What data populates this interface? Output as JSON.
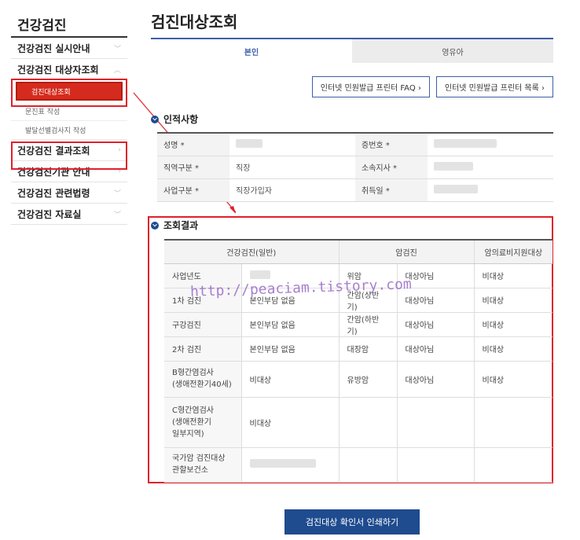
{
  "sidebar": {
    "title": "건강검진",
    "items": [
      {
        "label": "건강검진 실시안내"
      },
      {
        "label": "건강검진 대상자조회"
      },
      {
        "label": "건강검진 결과조회"
      },
      {
        "label": "건강검진기관 안내"
      },
      {
        "label": "건강검진 관련법령"
      },
      {
        "label": "건강검진 자료실"
      }
    ],
    "subitems": [
      {
        "label": "검진대상조회"
      },
      {
        "label": "문진표 작성"
      },
      {
        "label": "발달선별검사지 작성"
      }
    ]
  },
  "main": {
    "title": "검진대상조회",
    "tabs": [
      {
        "label": "본인"
      },
      {
        "label": "영유아"
      }
    ],
    "buttons": {
      "faq": "인터넷 민원발급 프린터 FAQ ›",
      "list": "인터넷 민원발급 프린터 목록 ›"
    },
    "personal": {
      "heading": "인적사항",
      "rows": [
        {
          "l1": "성명 *",
          "v1": "",
          "l2": "증번호 *",
          "v2": ""
        },
        {
          "l1": "직역구분 *",
          "v1": "직장",
          "l2": "소속지사 *",
          "v2": ""
        },
        {
          "l1": "사업구분 *",
          "v1": "직장가입자",
          "l2": "취득일 *",
          "v2": ""
        }
      ]
    },
    "results": {
      "heading": "조회결과",
      "headers": [
        "건강검진(일반)",
        "암검진",
        "암의료비지원대상"
      ],
      "rows": [
        {
          "label": "사업년도",
          "value": "",
          "cancer": "위암",
          "cancer_status": "대상아님",
          "support": "비대상"
        },
        {
          "label": "1차 검진",
          "value": "본인부담 없음",
          "cancer": "간암(상반기)",
          "cancer_status": "대상아님",
          "support": "비대상"
        },
        {
          "label": "구강검진",
          "value": "본인부담 없음",
          "cancer": "간암(하반기)",
          "cancer_status": "대상아님",
          "support": "비대상"
        },
        {
          "label": "2차 검진",
          "value": "본인부담 없음",
          "cancer": "대장암",
          "cancer_status": "대상아님",
          "support": "비대상"
        },
        {
          "label": "B형간염검사\n(생애전환기40세)",
          "value": "비대상",
          "cancer": "유방암",
          "cancer_status": "대상아님",
          "support": "비대상"
        },
        {
          "label": "C형간염검사\n(생애전환기\n일부지역)",
          "value": "비대상",
          "cancer": "",
          "cancer_status": "",
          "support": ""
        },
        {
          "label": "국가암 검진대상\n관할보건소",
          "value": "",
          "cancer": "",
          "cancer_status": "",
          "support": ""
        }
      ]
    },
    "print_button": "검진대상 확인서 인쇄하기"
  },
  "watermark": "http://peaciam.tistory.com"
}
